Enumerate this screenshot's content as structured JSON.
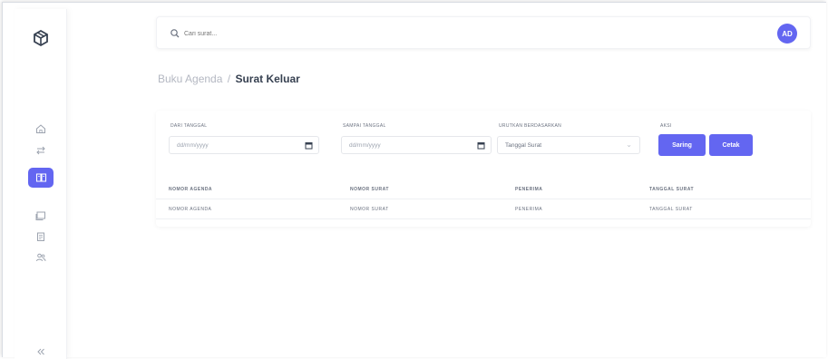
{
  "app": {
    "avatar_initials": "AD",
    "accent_color": "#6366f1"
  },
  "search": {
    "placeholder": "Cari surat..."
  },
  "sidebar": {
    "items": [
      {
        "icon": "home-icon"
      },
      {
        "icon": "swap-arrows-icon"
      },
      {
        "icon": "book-icon",
        "active": true
      },
      {
        "icon": "inbox-icon"
      },
      {
        "icon": "document-icon"
      },
      {
        "icon": "users-icon"
      }
    ],
    "collapse_icon": "double-chevron-left-icon"
  },
  "breadcrumb": {
    "parent": "Buku Agenda",
    "separator": "/",
    "current": "Surat Keluar"
  },
  "filters": {
    "from_date": {
      "label": "DARI TANGGAL",
      "placeholder": "dd/mm/yyyy"
    },
    "to_date": {
      "label": "SAMPAI TANGGAL",
      "placeholder": "dd/mm/yyyy"
    },
    "sort_by": {
      "label": "URUTKAN BERDASARKAN",
      "value": "Tanggal Surat"
    },
    "actions": {
      "label": "AKSI",
      "filter_label": "Saring",
      "print_label": "Cetak"
    }
  },
  "table": {
    "columns": [
      "NOMOR AGENDA",
      "NOMOR SURAT",
      "PENERIMA",
      "TANGGAL SURAT"
    ],
    "rows": [
      [
        "NOMOR AGENDA",
        "NOMOR SURAT",
        "PENERIMA",
        "TANGGAL SURAT"
      ]
    ]
  }
}
